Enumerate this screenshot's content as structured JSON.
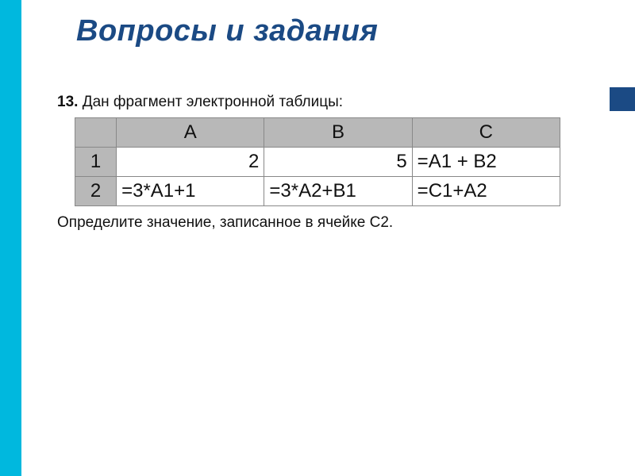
{
  "title": "Вопросы и задания",
  "question": {
    "number": "13.",
    "text": " Дан фрагмент электронной таблицы:"
  },
  "spreadsheet": {
    "columns": [
      "А",
      "В",
      "С"
    ],
    "rows": [
      {
        "label": "1",
        "cells": [
          {
            "value": "2",
            "numeric": true
          },
          {
            "value": "5",
            "numeric": true
          },
          {
            "value": "=A1 + B2",
            "numeric": false
          }
        ]
      },
      {
        "label": "2",
        "cells": [
          {
            "value": "=3*A1+1",
            "numeric": false
          },
          {
            "value": "=3*A2+B1",
            "numeric": false
          },
          {
            "value": "=C1+A2",
            "numeric": false
          }
        ]
      }
    ]
  },
  "followup": "Определите значение, записанное в ячейке С2."
}
